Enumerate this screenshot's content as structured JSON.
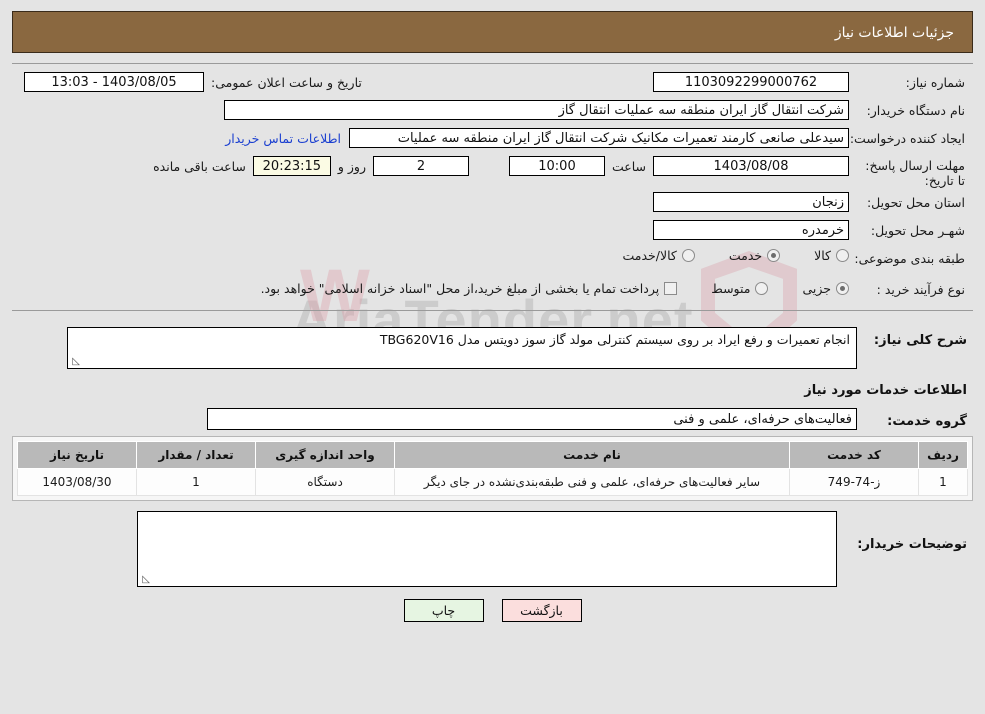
{
  "header": {
    "title": "جزئیات اطلاعات نیاز"
  },
  "watermark": {
    "text": "AriaTender.net"
  },
  "form": {
    "need_number_label": "شماره نیاز:",
    "need_number_value": "1103092299000762",
    "announce_datetime_label": "تاریخ و ساعت اعلان عمومی:",
    "announce_datetime_value": "1403/08/05 - 13:03",
    "buyer_org_label": "نام دستگاه خریدار:",
    "buyer_org_value": "شرکت انتقال گاز ایران منطقه سه عملیات انتقال گاز",
    "requester_label": "ایجاد کننده درخواست:",
    "requester_value": "سیدعلی صانعی کارمند تعمیرات مکانیک شرکت انتقال گاز ایران منطقه سه عملیات",
    "buyer_contact_link": "اطلاعات تماس خریدار",
    "deadline_label": "مهلت ارسال پاسخ: تا تاریخ:",
    "deadline_date": "1403/08/08",
    "hour_label": "ساعت",
    "deadline_time": "10:00",
    "days_remaining": "2",
    "days_label": "روز و",
    "countdown": "20:23:15",
    "remaining_label": "ساعت باقی مانده",
    "province_label": "استان محل تحویل:",
    "province_value": "زنجان",
    "city_label": "شهـر محل تحویل:",
    "city_value": "خرمدره",
    "category_label": "طبقه بندی موضوعی:",
    "category_options": [
      {
        "label": "کالا",
        "selected": false
      },
      {
        "label": "خدمت",
        "selected": true
      },
      {
        "label": "کالا/خدمت",
        "selected": false
      }
    ],
    "process_label": "نوع فرآیند خرید :",
    "process_options": [
      {
        "label": "جزیی",
        "selected": true
      },
      {
        "label": "متوسط",
        "selected": false
      }
    ],
    "treasury_checkbox_label": "پرداخت تمام یا بخشی از مبلغ خرید،از محل \"اسناد خزانه اسلامی\" خواهد بود.",
    "treasury_checked": false
  },
  "description": {
    "need_desc_label": "شرح کلی نیاز:",
    "need_desc_value": "انجام تعمیرات و رفع ایراد بر روی سیستم کنترلی مولد گاز سوز دویتس مدل TBG620V16",
    "services_section_title": "اطلاعات خدمات مورد نیاز",
    "service_group_label": "گروه خدمت:",
    "service_group_value": "فعالیت‌های حرفه‌ای، علمی و فنی"
  },
  "table": {
    "columns": [
      "ردیف",
      "کد خدمت",
      "نام خدمت",
      "واحد اندازه گیری",
      "تعداد / مقدار",
      "تاریخ نیاز"
    ],
    "rows": [
      {
        "row_no": "1",
        "service_code": "ز-74-749",
        "service_name": "سایر فعالیت‌های حرفه‌ای، علمی و فنی طبقه‌بندی‌نشده در جای دیگر",
        "unit": "دستگاه",
        "quantity": "1",
        "need_date": "1403/08/30"
      }
    ]
  },
  "buyer_comments": {
    "label": "توضیحات خریدار:",
    "value": ""
  },
  "buttons": {
    "print": "چاپ",
    "back": "بازگشت"
  }
}
